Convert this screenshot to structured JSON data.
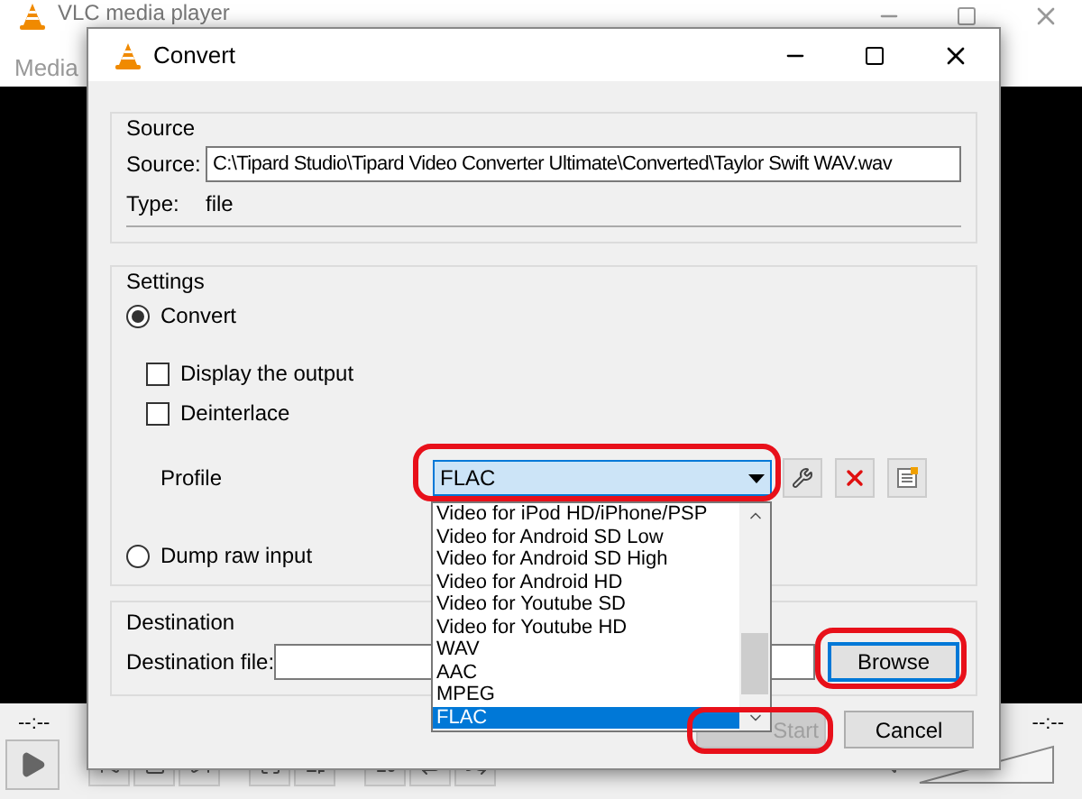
{
  "player": {
    "title": "VLC media player",
    "menu": [
      "Media"
    ],
    "time_elapsed": "--:--",
    "time_total": "--:--"
  },
  "dialog": {
    "title": "Convert",
    "source": {
      "heading": "Source",
      "label": "Source:",
      "value": "C:\\Tipard Studio\\Tipard Video Converter Ultimate\\Converted\\Taylor Swift WAV.wav",
      "type_label": "Type:",
      "type_value": "file"
    },
    "settings": {
      "heading": "Settings",
      "modes": [
        {
          "label": "Convert",
          "selected": true
        },
        {
          "label": "Dump raw input",
          "selected": false
        }
      ],
      "options": [
        {
          "label": "Display the output",
          "checked": false
        },
        {
          "label": "Deinterlace",
          "checked": false
        }
      ],
      "profile_label": "Profile",
      "profile_value": "FLAC",
      "profile_options": [
        {
          "label": "Video for iPod HD/iPhone/PSP",
          "selected": false
        },
        {
          "label": "Video for Android SD Low",
          "selected": false
        },
        {
          "label": "Video for Android SD High",
          "selected": false
        },
        {
          "label": "Video for Android HD",
          "selected": false
        },
        {
          "label": "Video for Youtube SD",
          "selected": false
        },
        {
          "label": "Video for Youtube HD",
          "selected": false
        },
        {
          "label": "WAV",
          "selected": false
        },
        {
          "label": "AAC",
          "selected": false
        },
        {
          "label": "MPEG",
          "selected": false
        },
        {
          "label": "FLAC",
          "selected": true
        }
      ]
    },
    "destination": {
      "heading": "Destination",
      "label": "Destination file:",
      "button": "Browse"
    },
    "buttons": [
      {
        "label": "Start",
        "disabled": true
      },
      {
        "label": "Cancel",
        "disabled": false
      }
    ]
  }
}
